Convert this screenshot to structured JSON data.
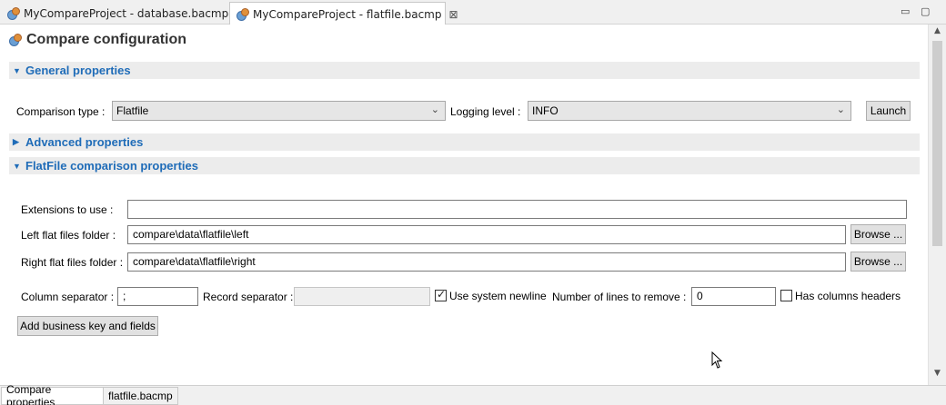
{
  "tabs": [
    {
      "label": "MyCompareProject - database.bacmp",
      "icon": "db-compare-icon"
    },
    {
      "label": "MyCompareProject - flatfile.bacmp",
      "icon": "db-compare-icon",
      "active": true,
      "close": "⊠"
    }
  ],
  "window": {
    "minimize": "▭",
    "maximize": "▢"
  },
  "page": {
    "title": "Compare configuration"
  },
  "sections": {
    "general": {
      "label": "General properties",
      "expanded": true
    },
    "advanced": {
      "label": "Advanced properties",
      "expanded": false
    },
    "flatfile": {
      "label": "FlatFile comparison properties",
      "expanded": true
    }
  },
  "general": {
    "comparison_type_label": "Comparison type :",
    "comparison_type_value": "Flatfile",
    "logging_level_label": "Logging level :",
    "logging_level_value": "INFO",
    "launch_label": "Launch"
  },
  "flatfile": {
    "extensions_label": "Extensions to use :",
    "extensions_value": "",
    "left_label": "Left flat files folder :",
    "left_value": "compare\\data\\flatfile\\left",
    "right_label": "Right flat files folder :",
    "right_value": "compare\\data\\flatfile\\right",
    "browse_label": "Browse ...",
    "column_sep_label": "Column separator :",
    "column_sep_value": ";",
    "record_sep_label": "Record separator :",
    "record_sep_value": "",
    "use_newline_label": "Use system newline",
    "use_newline_checked": true,
    "lines_remove_label": "Number of lines to remove :",
    "lines_remove_value": "0",
    "has_headers_label": "Has columns headers",
    "has_headers_checked": false,
    "add_key_label": "Add business key and fields"
  },
  "bottom_tabs": [
    "Compare properties",
    "flatfile.bacmp"
  ],
  "colors": {
    "section_text": "#1f6cb8",
    "section_bg": "#ececec"
  }
}
